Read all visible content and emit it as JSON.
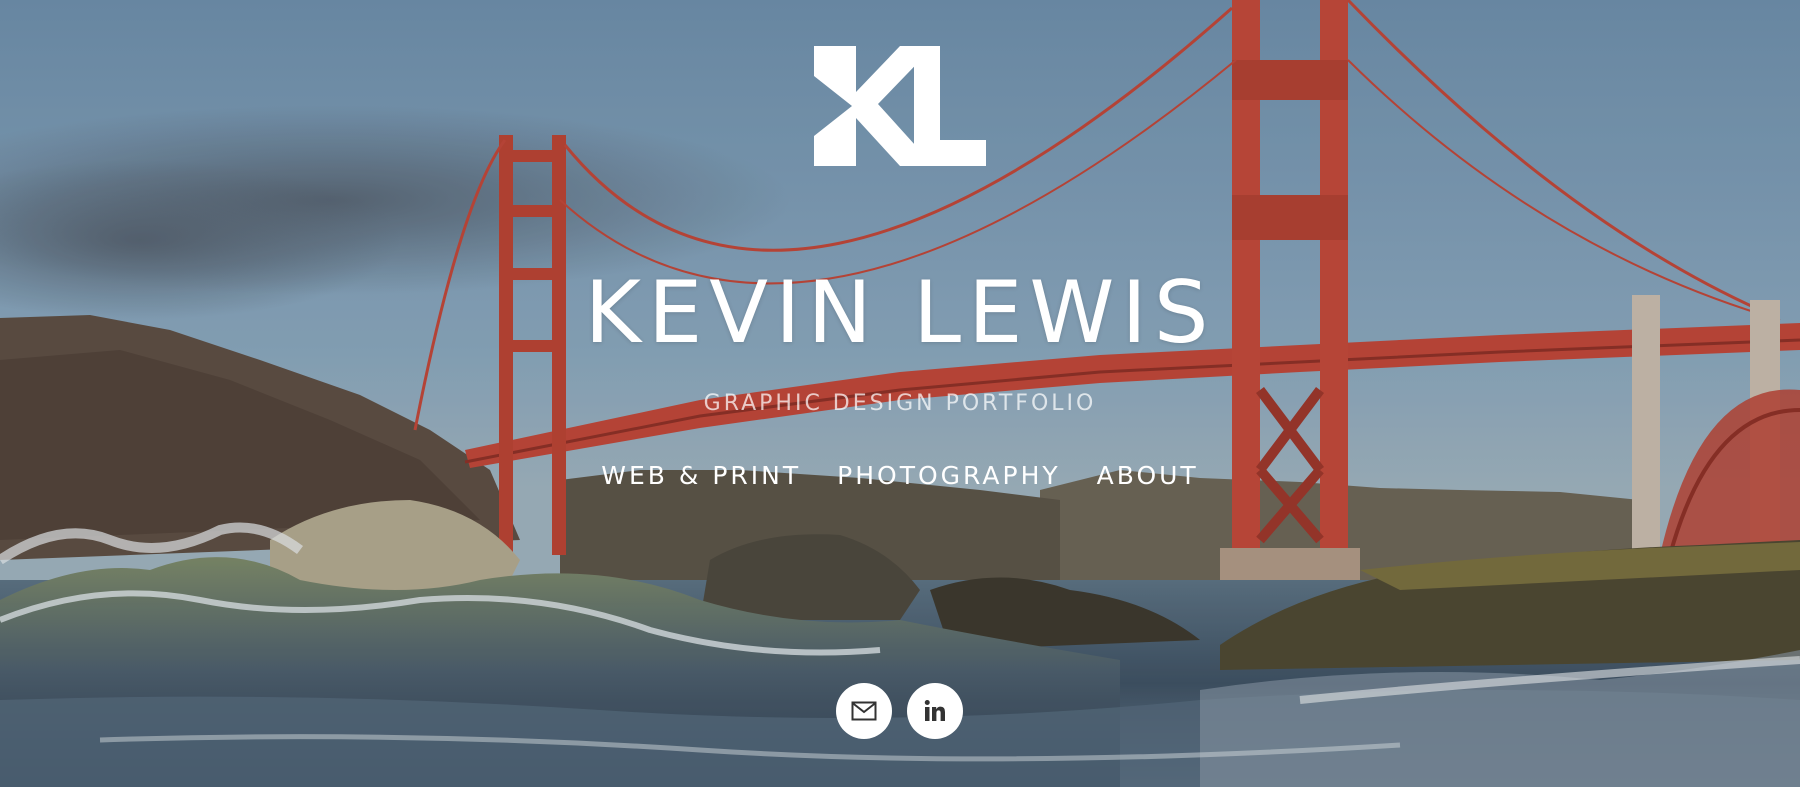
{
  "header": {
    "logo_text": "KL",
    "title": "KEVIN LEWIS",
    "tagline": "GRAPHIC DESIGN PORTFOLIO"
  },
  "nav": {
    "items": [
      {
        "label": "WEB & PRINT"
      },
      {
        "label": "PHOTOGRAPHY"
      },
      {
        "label": "ABOUT"
      }
    ]
  },
  "social": {
    "items": [
      {
        "icon": "mail-icon"
      },
      {
        "icon": "linkedin-icon"
      }
    ]
  },
  "colors": {
    "text": "#ffffff",
    "bridge": "#c0483a",
    "sky": "#6f8ea8"
  }
}
